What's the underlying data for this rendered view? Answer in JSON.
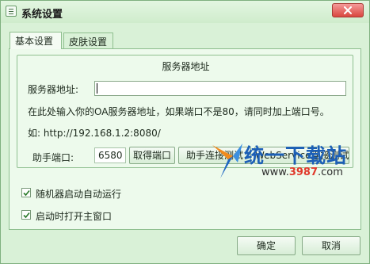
{
  "window": {
    "title": "系统设置",
    "close_icon": "close-icon"
  },
  "tabs": [
    {
      "label": "基本设置",
      "active": true
    },
    {
      "label": "皮肤设置",
      "active": false
    }
  ],
  "server_group": {
    "legend": "服务器地址",
    "address_label": "服务器地址:",
    "address_value": "",
    "hint": "在此处输入你的OA服务器地址，如果端口不是80，请同时加上端口号。",
    "example": "如: http://192.168.1.2:8080/",
    "port_label": "助手端口:",
    "port_value": "6580",
    "get_port_button": "取得端口",
    "test_assistant_button": "助手连接测试",
    "test_webservice_button": "WebService连接测试"
  },
  "options": [
    {
      "label": "随机器启动自动运行",
      "checked": true
    },
    {
      "label": "启动时打开主窗口",
      "checked": true
    }
  ],
  "watermark": {
    "text": "统一下载站",
    "url_prefix": "www.",
    "url_highlight": "3987",
    "url_suffix": ".com"
  },
  "footer": {
    "ok_button": "确定",
    "cancel_button": "取消"
  }
}
